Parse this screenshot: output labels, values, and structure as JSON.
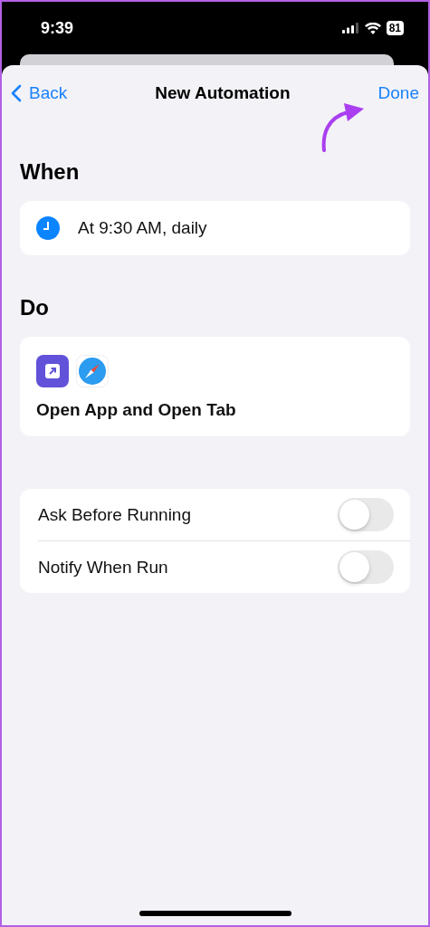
{
  "status_bar": {
    "time": "9:39",
    "battery": "81"
  },
  "nav": {
    "back": "Back",
    "title": "New Automation",
    "done": "Done"
  },
  "when": {
    "heading": "When",
    "trigger": "At 9:30 AM, daily"
  },
  "do": {
    "heading": "Do",
    "action": "Open App and Open Tab"
  },
  "options": [
    {
      "label": "Ask Before Running",
      "on": false
    },
    {
      "label": "Notify When Run",
      "on": false
    }
  ]
}
